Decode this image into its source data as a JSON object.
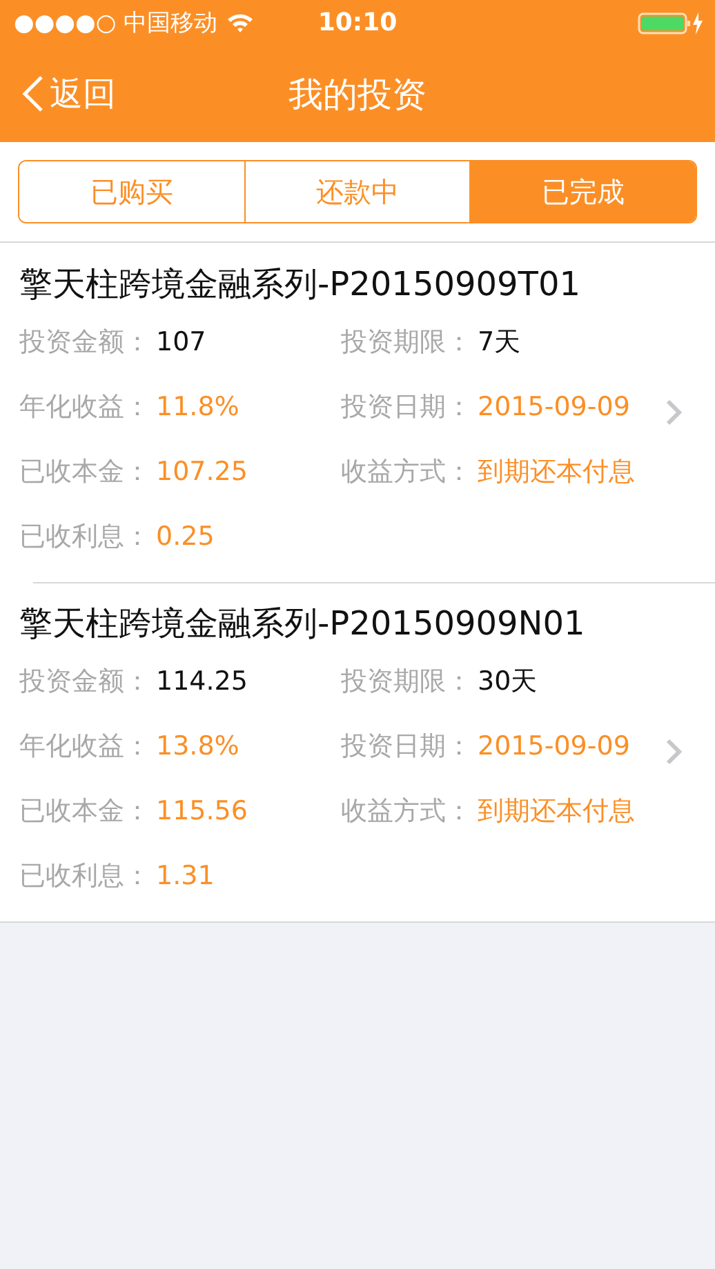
{
  "status_bar": {
    "carrier": "●●●●○ 中国移动",
    "time": "10:10"
  },
  "nav": {
    "back": "返回",
    "title": "我的投资"
  },
  "tabs": [
    {
      "label": "已购买",
      "selected": false
    },
    {
      "label": "还款中",
      "selected": false
    },
    {
      "label": "已完成",
      "selected": true
    }
  ],
  "investments": [
    {
      "title": "擎天柱跨境金融系列-P20150909T01",
      "fields": [
        {
          "label": "投资金额：",
          "value": "107",
          "highlight": false
        },
        {
          "label": "投资期限：",
          "value": "7天",
          "highlight": false
        },
        {
          "label": "年化收益：",
          "value": "11.8%",
          "highlight": true
        },
        {
          "label": "投资日期：",
          "value": "2015-09-09",
          "highlight": true
        },
        {
          "label": "已收本金：",
          "value": "107.25",
          "highlight": true
        },
        {
          "label": "收益方式：",
          "value": "到期还本付息",
          "highlight": true
        },
        {
          "label": "已收利息：",
          "value": "0.25",
          "highlight": true
        }
      ]
    },
    {
      "title": "擎天柱跨境金融系列-P20150909N01",
      "fields": [
        {
          "label": "投资金额：",
          "value": "114.25",
          "highlight": false
        },
        {
          "label": "投资期限：",
          "value": "30天",
          "highlight": false
        },
        {
          "label": "年化收益：",
          "value": "13.8%",
          "highlight": true
        },
        {
          "label": "投资日期：",
          "value": "2015-09-09",
          "highlight": true
        },
        {
          "label": "已收本金：",
          "value": "115.56",
          "highlight": true
        },
        {
          "label": "收益方式：",
          "value": "到期还本付息",
          "highlight": true
        },
        {
          "label": "已收利息：",
          "value": "1.31",
          "highlight": true
        }
      ]
    }
  ]
}
